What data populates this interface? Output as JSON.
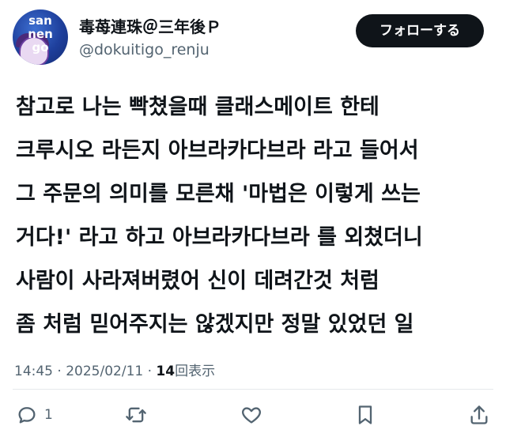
{
  "header": {
    "avatar_text": "san nen go",
    "display_name": "毒苺連珠＠三年後Ｐ",
    "handle": "@dokuitigo_renju",
    "follow_label": "フォローする"
  },
  "tweet": {
    "lines": [
      "참고로 나는 빡쳤을때 클래스메이트 한테",
      "크루시오 라든지 아브라카다브라 라고 들어서",
      "그 주문의 의미를 모른채 '마법은 이렇게 쓰는",
      "거다!' 라고 하고 아브라카다브라 를 외쳤더니",
      "사람이 사라져버렸어 신이 데려간것 처럼",
      "좀 처럼 믿어주지는 않겠지만 정말 있었던 일"
    ]
  },
  "meta": {
    "time": "14:45",
    "separator": " · ",
    "date": "2025/02/11",
    "views_count": "14",
    "views_label": "回表示"
  },
  "actions": {
    "reply_icon": "reply-icon",
    "reply_count": "1",
    "retweet_icon": "retweet-icon",
    "like_icon": "heart-icon",
    "bookmark_icon": "bookmark-icon",
    "share_icon": "share-icon"
  },
  "colors": {
    "text": "#0f1419",
    "secondary": "#536471",
    "button_bg": "#0f1419",
    "button_text": "#ffffff"
  }
}
